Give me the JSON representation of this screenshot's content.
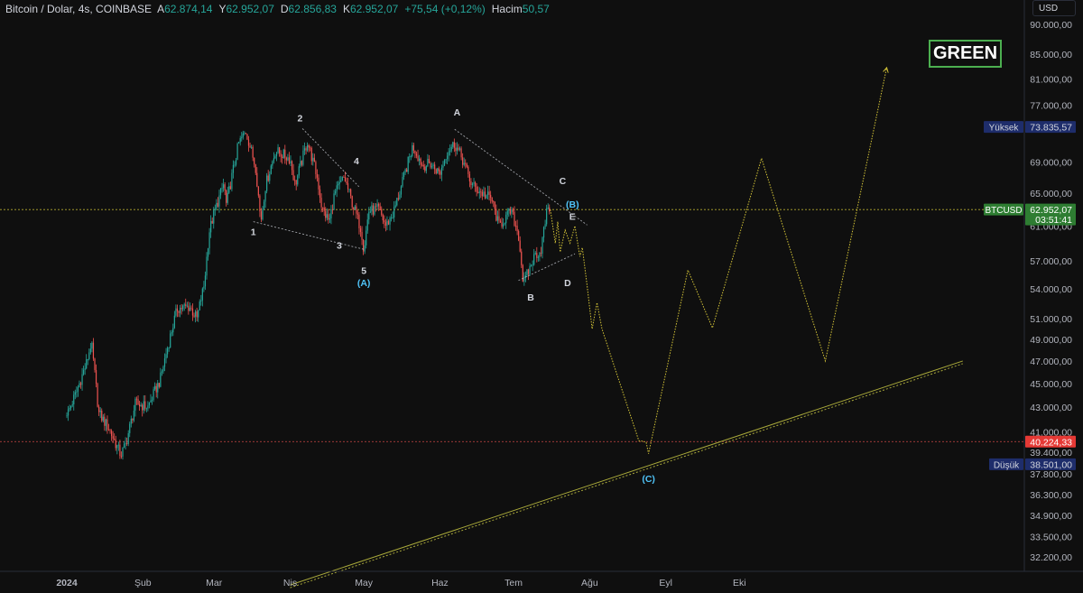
{
  "header": {
    "symbol": "Bitcoin / Dolar, 4s, COINBASE",
    "open_label": "A",
    "open": "62.874,14",
    "high_label": "Y",
    "high": "62.952,07",
    "low_label": "D",
    "low": "62.856,83",
    "close_label": "K",
    "close": "62.952,07",
    "change": "+75,54 (+0,12%)",
    "volume_label": "Hacim",
    "volume": "50,57"
  },
  "currency": "USD",
  "badge": "GREEN",
  "colors": {
    "up": "#26a69a",
    "down": "#ef5350",
    "projection": "#d4c437",
    "wave": "#d1d4dc",
    "wave_blue": "#4fc3f7",
    "trendline": "#a8a83a"
  },
  "chart_data": {
    "type": "line",
    "title": "",
    "price_axis": {
      "ticks": [
        "90.000,00",
        "85.000,00",
        "81.000,00",
        "77.000,00",
        "69.000,00",
        "65.000,00",
        "61.000,00",
        "57.000,00",
        "54.000,00",
        "51.000,00",
        "49.000,00",
        "47.000,00",
        "45.000,00",
        "43.000,00",
        "41.000,00",
        "39.400,00",
        "37.800,00",
        "36.300,00",
        "34.900,00",
        "33.500,00",
        "32.200,00"
      ],
      "tick_values": [
        90000,
        85000,
        81000,
        77000,
        69000,
        65000,
        61000,
        57000,
        54000,
        51000,
        49000,
        47000,
        45000,
        43000,
        41000,
        39400,
        37800,
        36300,
        34900,
        33500,
        32200
      ],
      "scale": "log"
    },
    "time_axis": {
      "ticks": [
        "2024",
        "Şub",
        "Mar",
        "Nis",
        "May",
        "Haz",
        "Tem",
        "Ağu",
        "Eyl",
        "Eki"
      ],
      "tick_dates": [
        "2024-01-01",
        "2024-02-01",
        "2024-03-01",
        "2024-04-01",
        "2024-05-01",
        "2024-06-01",
        "2024-07-01",
        "2024-08-01",
        "2024-09-01",
        "2024-10-01"
      ]
    },
    "price_labels": [
      {
        "label": "Yüksek",
        "value": "73.835,57",
        "price": 73835.57,
        "kind": "high"
      },
      {
        "label": "BTCUSD",
        "value": "62.952,07",
        "sub": "03:51:41",
        "price": 62952.07,
        "kind": "last"
      },
      {
        "value": "40.224,33",
        "price": 40224.33,
        "kind": "level"
      },
      {
        "label": "Düşük",
        "value": "38.501,00",
        "price": 38501,
        "kind": "low"
      }
    ],
    "price_series": {
      "name": "BTCUSD",
      "points": [
        [
          "2024-01-01",
          42300
        ],
        [
          "2024-01-05",
          44300
        ],
        [
          "2024-01-09",
          46800
        ],
        [
          "2024-01-11",
          48700
        ],
        [
          "2024-01-14",
          42500
        ],
        [
          "2024-01-18",
          41300
        ],
        [
          "2024-01-23",
          39200
        ],
        [
          "2024-01-25",
          40000
        ],
        [
          "2024-01-29",
          43300
        ],
        [
          "2024-02-03",
          43000
        ],
        [
          "2024-02-08",
          45300
        ],
        [
          "2024-02-11",
          48200
        ],
        [
          "2024-02-15",
          52000
        ],
        [
          "2024-02-20",
          52200
        ],
        [
          "2024-02-23",
          51000
        ],
        [
          "2024-02-26",
          54500
        ],
        [
          "2024-02-28",
          60300
        ],
        [
          "2024-03-01",
          62500
        ],
        [
          "2024-03-05",
          66200
        ],
        [
          "2024-03-06",
          63500
        ],
        [
          "2024-03-11",
          71500
        ],
        [
          "2024-03-14",
          73200
        ],
        [
          "2024-03-18",
          68200
        ],
        [
          "2024-03-20",
          61500
        ],
        [
          "2024-03-22",
          66000
        ],
        [
          "2024-03-26",
          70500
        ],
        [
          "2024-03-29",
          70000
        ],
        [
          "2024-04-01",
          69400
        ],
        [
          "2024-04-03",
          66000
        ],
        [
          "2024-04-08",
          71800
        ],
        [
          "2024-04-12",
          67000
        ],
        [
          "2024-04-14",
          63000
        ],
        [
          "2024-04-17",
          61500
        ],
        [
          "2024-04-19",
          64800
        ],
        [
          "2024-04-23",
          67000
        ],
        [
          "2024-04-26",
          64000
        ],
        [
          "2024-04-30",
          60500
        ],
        [
          "2024-05-01",
          58200
        ],
        [
          "2024-05-03",
          62800
        ],
        [
          "2024-05-07",
          63000
        ],
        [
          "2024-05-10",
          61000
        ],
        [
          "2024-05-13",
          62500
        ],
        [
          "2024-05-16",
          65500
        ],
        [
          "2024-05-21",
          71200
        ],
        [
          "2024-05-25",
          68500
        ],
        [
          "2024-05-28",
          68800
        ],
        [
          "2024-06-01",
          67500
        ],
        [
          "2024-06-04",
          70500
        ],
        [
          "2024-06-07",
          71500
        ],
        [
          "2024-06-10",
          69500
        ],
        [
          "2024-06-14",
          66000
        ],
        [
          "2024-06-18",
          65000
        ],
        [
          "2024-06-22",
          64300
        ],
        [
          "2024-06-25",
          61000
        ],
        [
          "2024-06-27",
          61700
        ],
        [
          "2024-06-30",
          62800
        ],
        [
          "2024-07-03",
          60000
        ],
        [
          "2024-07-05",
          54500
        ],
        [
          "2024-07-08",
          56500
        ],
        [
          "2024-07-10",
          57800
        ],
        [
          "2024-07-12",
          58000
        ],
        [
          "2024-07-15",
          63500
        ],
        [
          "2024-07-16",
          62952
        ]
      ]
    },
    "projection": {
      "name": "",
      "points": [
        [
          "2024-07-16",
          62952
        ],
        [
          "2024-07-18",
          59000
        ],
        [
          "2024-07-19",
          61500
        ],
        [
          "2024-07-20",
          58000
        ],
        [
          "2024-07-22",
          60500
        ],
        [
          "2024-07-24",
          59000
        ],
        [
          "2024-07-26",
          61000
        ],
        [
          "2024-07-28",
          57500
        ],
        [
          "2024-07-29",
          58500
        ],
        [
          "2024-07-31",
          54300
        ],
        [
          "2024-08-02",
          50000
        ],
        [
          "2024-08-04",
          52600
        ],
        [
          "2024-08-06",
          50000
        ],
        [
          "2024-08-21",
          40300
        ],
        [
          "2024-08-24",
          40200
        ],
        [
          "2024-08-25",
          39300
        ],
        [
          "2024-09-10",
          56000
        ],
        [
          "2024-09-20",
          50100
        ],
        [
          "2024-10-10",
          69500
        ],
        [
          "2024-11-05",
          47000
        ],
        [
          "2024-11-30",
          82800
        ]
      ]
    },
    "wave_lines": [
      {
        "from": [
          "2024-03-17",
          61500
        ],
        "to": [
          "2024-05-01",
          58300
        ]
      },
      {
        "from": [
          "2024-04-06",
          73600
        ],
        "to": [
          "2024-04-29",
          65800
        ]
      },
      {
        "from": [
          "2024-06-07",
          73500
        ],
        "to": [
          "2024-07-31",
          61100
        ]
      },
      {
        "from": [
          "2024-07-03",
          54900
        ],
        "to": [
          "2024-07-26",
          57800
        ]
      }
    ],
    "trendline": {
      "from": [
        "2024-04-01",
        30500
      ],
      "to": [
        "2024-12-31",
        47000
      ]
    },
    "horizontal_levels": [
      {
        "price": 62952.07,
        "color": "#d4c437"
      },
      {
        "price": 40224.33,
        "color": "#ef5350"
      }
    ],
    "wave_labels": [
      {
        "text": "1",
        "date": "2024-03-17",
        "price": 59900,
        "color": "wave"
      },
      {
        "text": "2",
        "date": "2024-04-05",
        "price": 74600,
        "color": "wave"
      },
      {
        "text": "3",
        "date": "2024-04-21",
        "price": 58400,
        "color": "wave"
      },
      {
        "text": "4",
        "date": "2024-04-28",
        "price": 68700,
        "color": "wave"
      },
      {
        "text": "5",
        "date": "2024-05-01",
        "price": 55600,
        "color": "wave"
      },
      {
        "text": "(A)",
        "date": "2024-05-01",
        "price": 54300,
        "color": "wave_blue"
      },
      {
        "text": "A",
        "date": "2024-06-08",
        "price": 75500,
        "color": "wave"
      },
      {
        "text": "B",
        "date": "2024-07-08",
        "price": 52800,
        "color": "wave"
      },
      {
        "text": "C",
        "date": "2024-07-21",
        "price": 66100,
        "color": "wave"
      },
      {
        "text": "(B)",
        "date": "2024-07-25",
        "price": 63200,
        "color": "wave_blue"
      },
      {
        "text": "E",
        "date": "2024-07-25",
        "price": 61700,
        "color": "wave"
      },
      {
        "text": "D",
        "date": "2024-07-23",
        "price": 54300,
        "color": "wave"
      },
      {
        "text": "(C)",
        "date": "2024-08-25",
        "price": 37200,
        "color": "wave_blue"
      }
    ]
  }
}
